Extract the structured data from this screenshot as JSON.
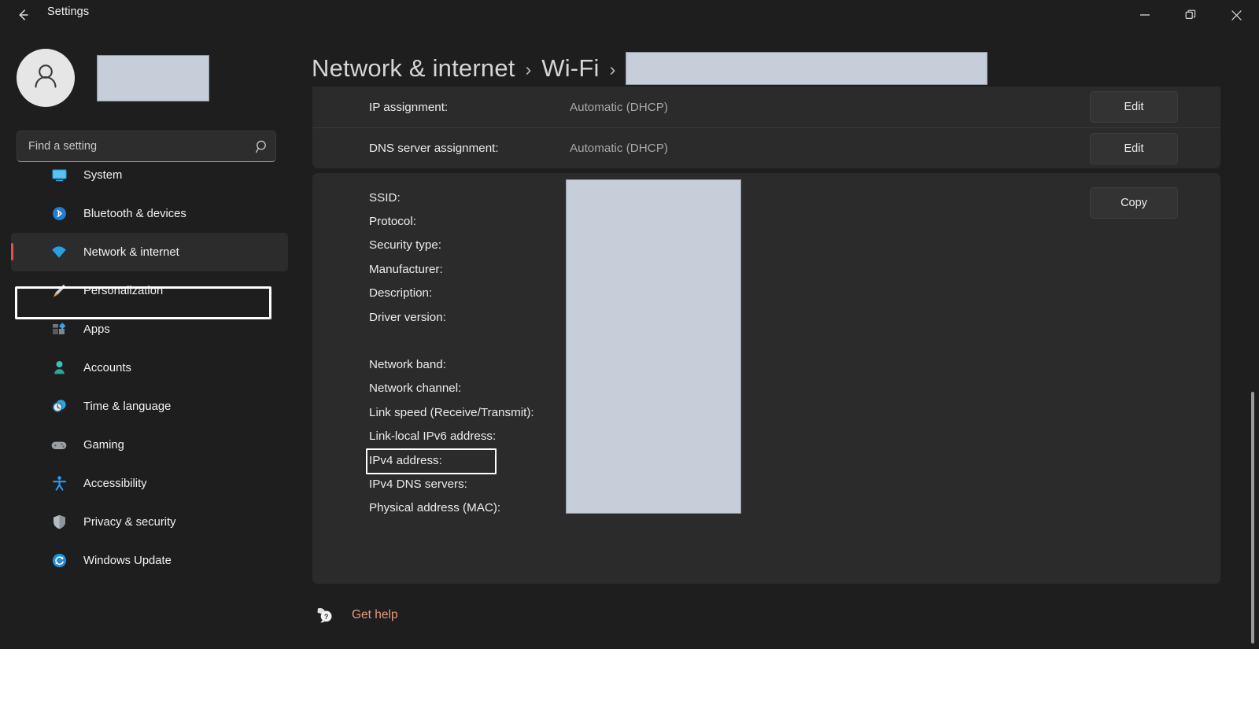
{
  "window": {
    "title": "Settings",
    "back_icon": "back-arrow-icon",
    "minimize_label": "Minimize",
    "restore_label": "Restore",
    "close_label": "Close"
  },
  "sidebar": {
    "profile": {
      "avatar_icon": "person-avatar-icon",
      "name": ""
    },
    "search": {
      "placeholder": "Find a setting",
      "value": "",
      "icon": "search-icon"
    },
    "items": [
      {
        "label": "System",
        "icon": "monitor-icon",
        "selected": false
      },
      {
        "label": "Bluetooth & devices",
        "icon": "bluetooth-icon",
        "selected": false
      },
      {
        "label": "Network & internet",
        "icon": "wifi-icon",
        "selected": true
      },
      {
        "label": "Personalization",
        "icon": "paintbrush-icon",
        "selected": false
      },
      {
        "label": "Apps",
        "icon": "apps-icon",
        "selected": false
      },
      {
        "label": "Accounts",
        "icon": "account-icon",
        "selected": false
      },
      {
        "label": "Time & language",
        "icon": "clock-icon",
        "selected": false
      },
      {
        "label": "Gaming",
        "icon": "gamepad-icon",
        "selected": false
      },
      {
        "label": "Accessibility",
        "icon": "accessibility-icon",
        "selected": false
      },
      {
        "label": "Privacy & security",
        "icon": "shield-icon",
        "selected": false
      },
      {
        "label": "Windows Update",
        "icon": "update-icon",
        "selected": false
      }
    ]
  },
  "main": {
    "breadcrumb": {
      "root": "Network & internet",
      "separator": "›",
      "second": "Wi-Fi",
      "third_redacted": ""
    },
    "settings_rows": [
      {
        "label": "IP assignment:",
        "value": "Automatic (DHCP)",
        "button": "Edit"
      },
      {
        "label": "DNS server assignment:",
        "value": "Automatic (DHCP)",
        "button": "Edit"
      }
    ],
    "properties": {
      "copy_button": "Copy",
      "group_one": [
        "SSID:",
        "Protocol:",
        "Security type:",
        "Manufacturer:",
        "Description:",
        "Driver version:"
      ],
      "group_two": [
        "Network band:",
        "Network channel:",
        "Link speed (Receive/Transmit):",
        "Link-local IPv6 address:",
        "IPv4 address:",
        "IPv4 DNS servers:",
        "Physical address (MAC):"
      ],
      "highlighted_label": "IPv4 address:",
      "values_redacted": ""
    },
    "get_help": {
      "label": "Get help",
      "icon": "help-question-icon"
    }
  },
  "colors": {
    "page_background": "#1e1e1e",
    "card_background": "#2b2b2b",
    "redaction_fill": "#c6ced9",
    "accent_link": "#e79a7c",
    "selection_bar": "#d9534f",
    "annotation_outline": "#ffffff",
    "text_primary": "#ececec",
    "text_secondary": "#a8a8a8"
  }
}
